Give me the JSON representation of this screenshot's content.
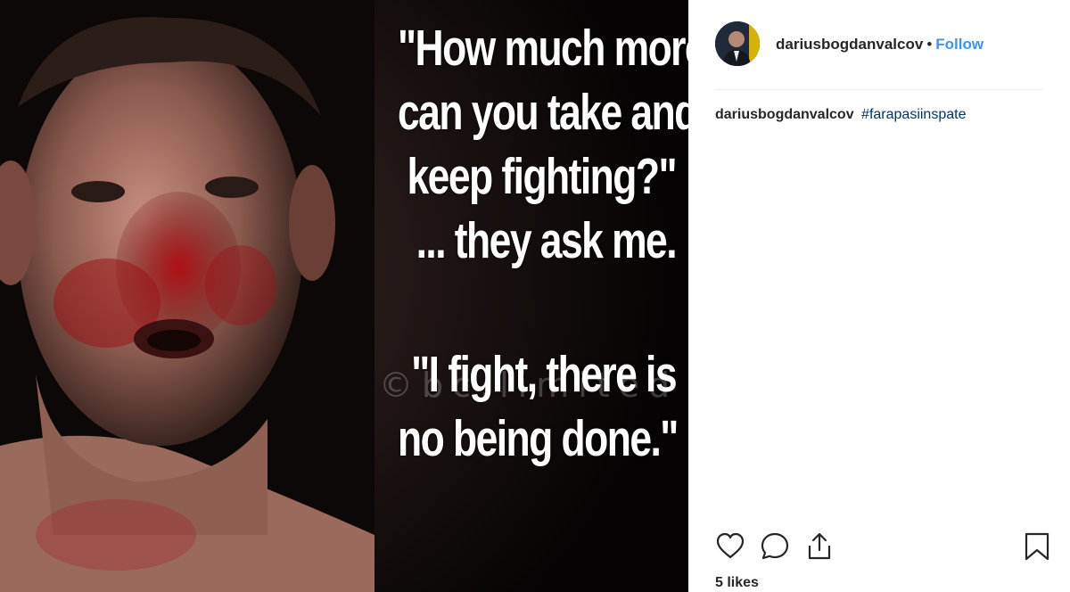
{
  "post": {
    "image": {
      "quote_lines_top": [
        "\"How much more",
        "can you take and",
        "keep fighting?\"",
        "... they ask me."
      ],
      "quote_lines_bottom": [
        "\"I fight, there is",
        "no being done.\""
      ],
      "watermark": "©bc.limited"
    }
  },
  "header": {
    "username": "dariusbogdanvalcov",
    "separator": "•",
    "follow_label": "Follow"
  },
  "caption": {
    "username": "dariusbogdanvalcov",
    "hashtag": "#farapasiinspate"
  },
  "actions": {
    "icons": [
      "heart-icon",
      "comment-icon",
      "share-icon",
      "bookmark-icon"
    ]
  },
  "likes": "5 likes",
  "colors": {
    "link": "#3897f0",
    "hashtag": "#003569",
    "text": "#262626",
    "divider": "#efefef"
  }
}
